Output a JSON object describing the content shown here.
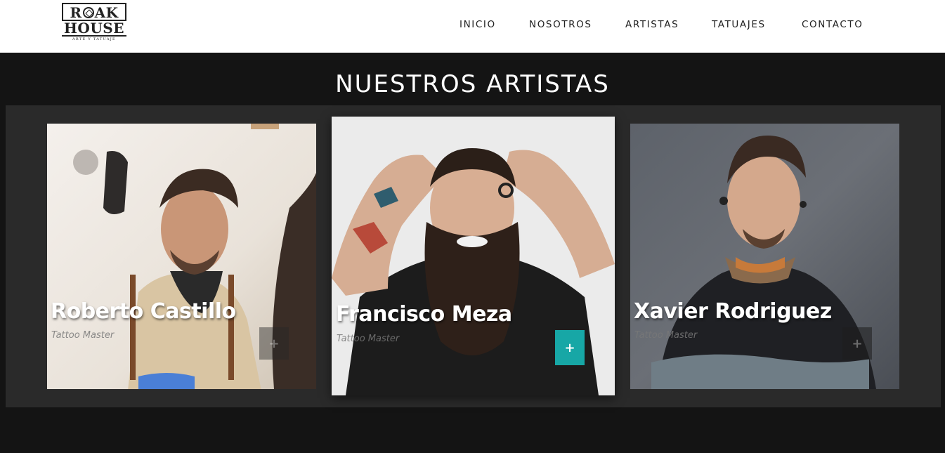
{
  "logo": {
    "line1": "ROAK",
    "line2": "HOUSE",
    "tagline": "ARTE Y TATUAJE"
  },
  "nav": {
    "items": [
      {
        "label": "INICIO"
      },
      {
        "label": "NOSOTROS"
      },
      {
        "label": "ARTISTAS"
      },
      {
        "label": "TATUAJES"
      },
      {
        "label": "CONTACTO"
      }
    ]
  },
  "section": {
    "title": "NUESTROS ARTISTAS"
  },
  "artists": [
    {
      "name": "Roberto Castillo",
      "role": "Tattoo Master",
      "action_icon": "plus-icon"
    },
    {
      "name": "Francisco Meza",
      "role": "Tattoo Master",
      "action_icon": "plus-icon",
      "highlighted": true
    },
    {
      "name": "Xavier Rodriguez",
      "role": "Tattoo Master",
      "action_icon": "plus-icon"
    }
  ],
  "colors": {
    "page_background": "#141414",
    "band_background": "#2a2a2a",
    "header_background": "#ffffff",
    "accent": "#17a7a6"
  },
  "icons": {
    "plus": "+"
  }
}
